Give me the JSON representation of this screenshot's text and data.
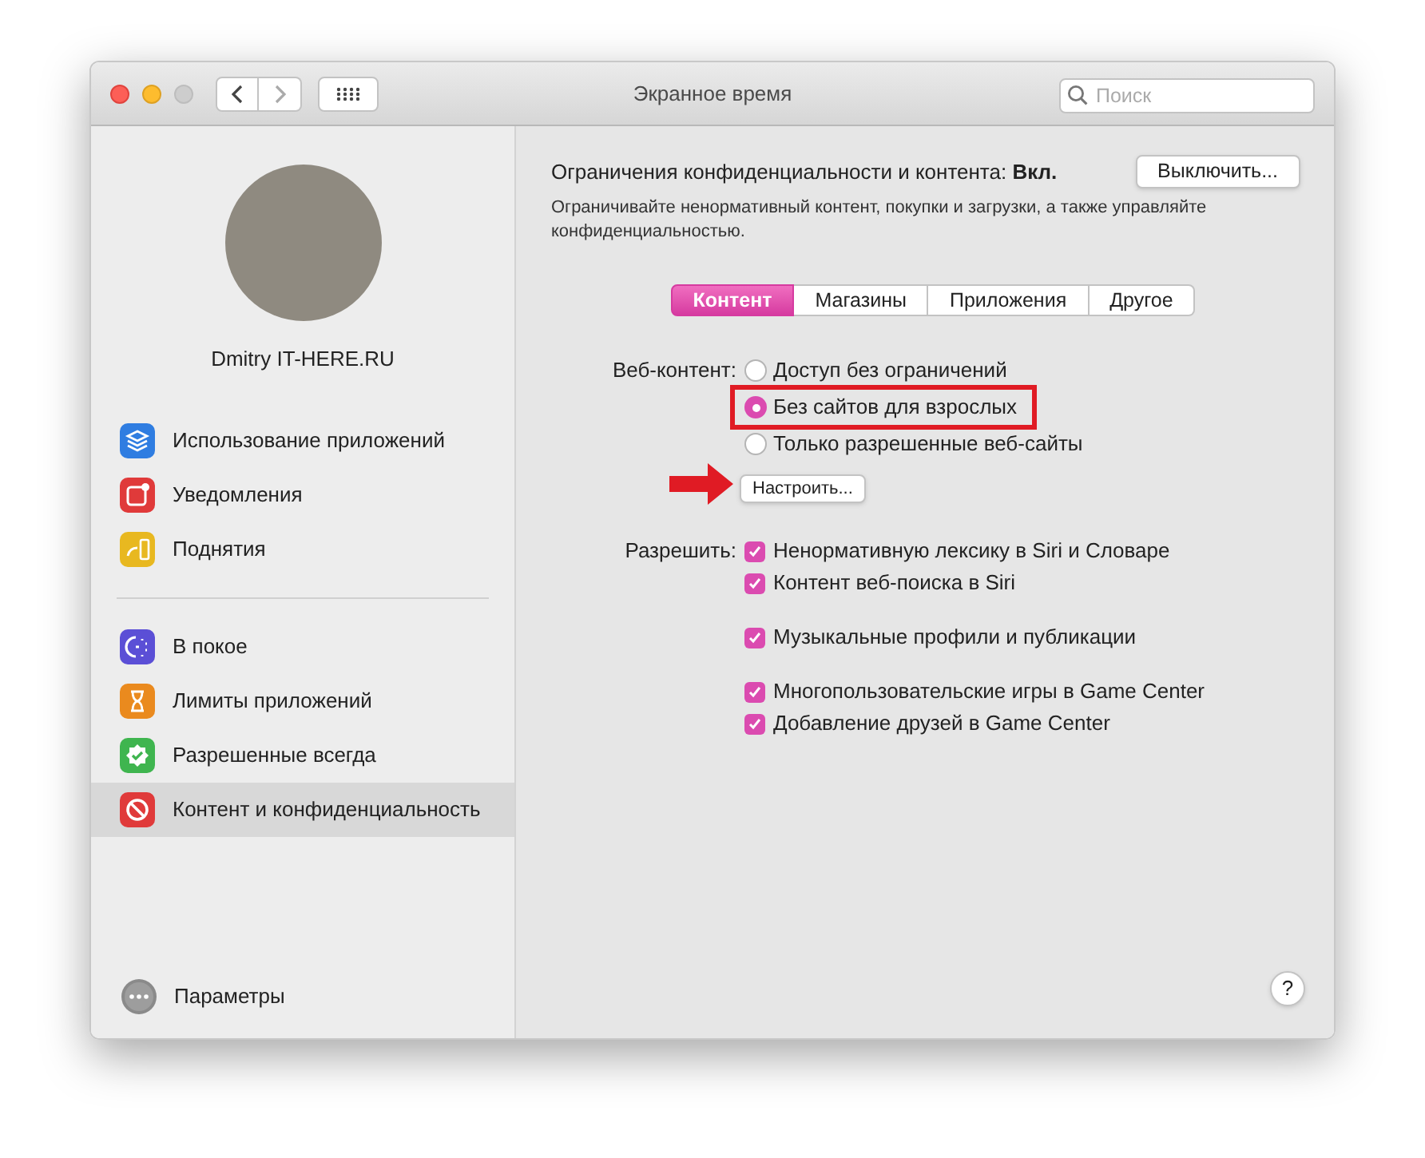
{
  "window": {
    "title": "Экранное время"
  },
  "search": {
    "placeholder": "Поиск"
  },
  "user": {
    "name": "Dmitry IT-HERE.RU"
  },
  "sidebar": {
    "groups": [
      {
        "items": [
          {
            "label": "Использование приложений",
            "color": "#2f7de1",
            "selected": false
          },
          {
            "label": "Уведомления",
            "color": "#e03a3a",
            "selected": false
          },
          {
            "label": "Поднятия",
            "color": "#e8b820",
            "selected": false
          }
        ]
      },
      {
        "items": [
          {
            "label": "В покое",
            "color": "#5b4fd6",
            "selected": false
          },
          {
            "label": "Лимиты приложений",
            "color": "#ea8a1e",
            "selected": false
          },
          {
            "label": "Разрешенные всегда",
            "color": "#3fb54f",
            "selected": false
          },
          {
            "label": "Контент и конфиденциальность",
            "color": "#e03a3a",
            "selected": true
          }
        ]
      }
    ],
    "footer": {
      "label": "Параметры"
    }
  },
  "restrictions": {
    "label": "Ограничения конфиденциальности и контента: **Вкл.**",
    "button": "Выключить...",
    "description": "Ограничивайте ненормативный контент, покупки и загрузки, а также управляйте конфиденциальностью."
  },
  "tabs": [
    {
      "label": "Контент",
      "selected": true
    },
    {
      "label": "Магазины",
      "selected": false
    },
    {
      "label": "Приложения",
      "selected": false
    },
    {
      "label": "Другое",
      "selected": false
    }
  ],
  "web_content": {
    "label": "Веб-контент:",
    "options": [
      {
        "label": "Доступ без ограничений",
        "selected": false,
        "highlighted": false
      },
      {
        "label": "Без сайтов для взрослых",
        "selected": true,
        "highlighted": true
      },
      {
        "label": "Только разрешенные веб-сайты",
        "selected": false,
        "highlighted": false
      }
    ],
    "button": {
      "label": "Настроить...",
      "arrow": true
    }
  },
  "allow": {
    "label": "Разрешить:",
    "groups": [
      [
        {
          "label": "Ненормативную лексику в Siri и Словаре",
          "checked": true
        },
        {
          "label": "Контент веб-поиска в Siri",
          "checked": true
        }
      ],
      [
        {
          "label": "Музыкальные профили и публикации",
          "checked": true
        }
      ],
      [
        {
          "label": "Многопользовательские игры в Game Center",
          "checked": true
        },
        {
          "label": "Добавление друзей в Game Center",
          "checked": true
        }
      ]
    ]
  },
  "help": {
    "label": "?"
  }
}
